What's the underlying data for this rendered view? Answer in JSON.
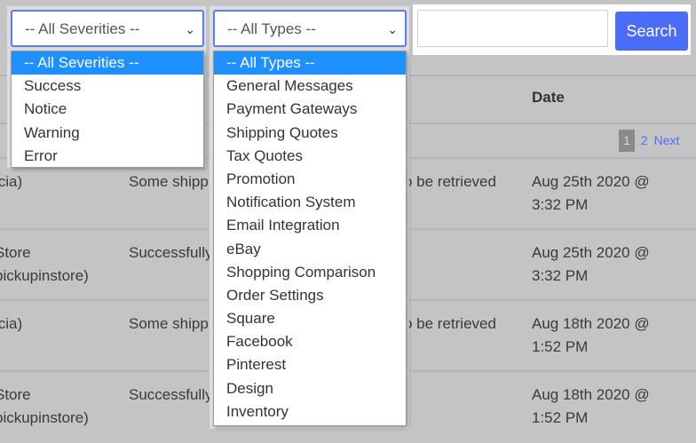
{
  "filters": {
    "severity_value": "-- All Severities --",
    "type_value": "-- All Types --",
    "search_value": "",
    "search_label": "Search"
  },
  "severity_options": [
    "-- All Severities --",
    "Success",
    "Notice",
    "Warning",
    "Error"
  ],
  "type_options": [
    "-- All Types --",
    "General Messages",
    "Payment Gateways",
    "Shipping Quotes",
    "Tax Quotes",
    "Promotion",
    "Notification System",
    "Email Integration",
    "eBay",
    "Shopping Comparison",
    "Order Settings",
    "Square",
    "Facebook",
    "Pinterest",
    "Design",
    "Inventory"
  ],
  "table": {
    "date_header": "Date",
    "pagination": {
      "current": "1",
      "next_page": "2",
      "next_label": "Next"
    },
    "rows": [
      {
        "module": "icia)",
        "module2": "",
        "message": "Some shipp",
        "message_end": "o be retrieved",
        "date": "Aug 25th 2020 @",
        "time": "3:32 PM"
      },
      {
        "module": "Store",
        "module2": "pickupinstore)",
        "message": "Successfully",
        "message_end": "",
        "date": "Aug 25th 2020 @",
        "time": "3:32 PM"
      },
      {
        "module": "icia)",
        "module2": "",
        "message": "Some shipp",
        "message_end": "o be retrieved",
        "date": "Aug 18th 2020 @",
        "time": "1:52 PM"
      },
      {
        "module": "Store",
        "module2": "pickupinstore)",
        "message": "Successfully",
        "message_end": "",
        "date": "Aug 18th 2020 @",
        "time": "1:52 PM"
      }
    ]
  }
}
